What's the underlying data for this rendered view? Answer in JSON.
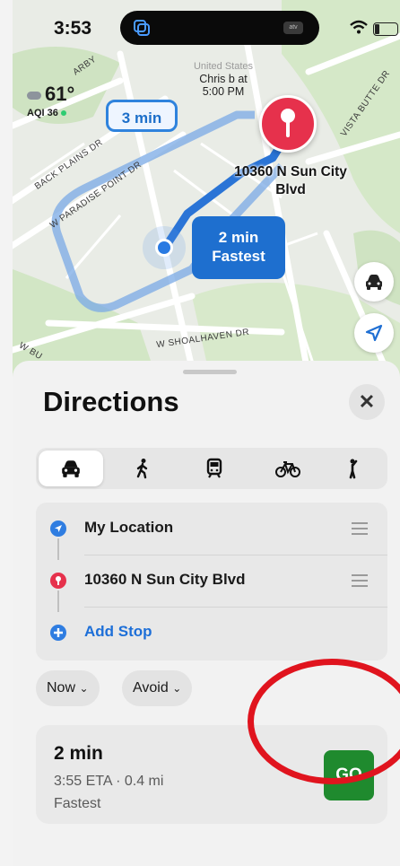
{
  "status_bar": {
    "time": "3:53",
    "island_icon": "apple-tv-icon",
    "island_tag": "atv"
  },
  "map": {
    "weather": {
      "temperature": "61°",
      "aqi_label": "AQI 36"
    },
    "poi_country": "United States",
    "poi_label": "Chris b at 5:00 PM",
    "alt_route_bubble": "3 min",
    "main_route_bubble": {
      "time": "2 min",
      "tag": "Fastest"
    },
    "destination_label": "10360 N Sun City Blvd",
    "streets": [
      "BACK PLAINS DR",
      "W PARADISE POINT DR",
      "W SHOALHAVEN DR",
      "VISTA BUTTE DR",
      "ARBY",
      "W BU"
    ],
    "route_color": "#2a74d6",
    "pin_color": "#e6314c"
  },
  "sheet": {
    "title": "Directions",
    "close_icon": "close-icon",
    "modes": [
      "drive",
      "walk",
      "transit",
      "cycle",
      "ride"
    ],
    "active_mode": "drive",
    "stops": [
      {
        "label": "My Location",
        "icon": "location-arrow-icon",
        "color": "#2f7de1"
      },
      {
        "label": "10360 N Sun City Blvd",
        "icon": "pin-icon",
        "color": "#e6314c"
      }
    ],
    "add_stop_label": "Add Stop",
    "chips": {
      "now_label": "Now",
      "avoid_label": "Avoid"
    },
    "route": {
      "time": "2 min",
      "eta": "3:55 ETA · 0.4 mi",
      "tag": "Fastest",
      "go_label": "GO",
      "go_color": "#1f8a2e"
    }
  },
  "annotation": {
    "color": "#e0141e"
  }
}
